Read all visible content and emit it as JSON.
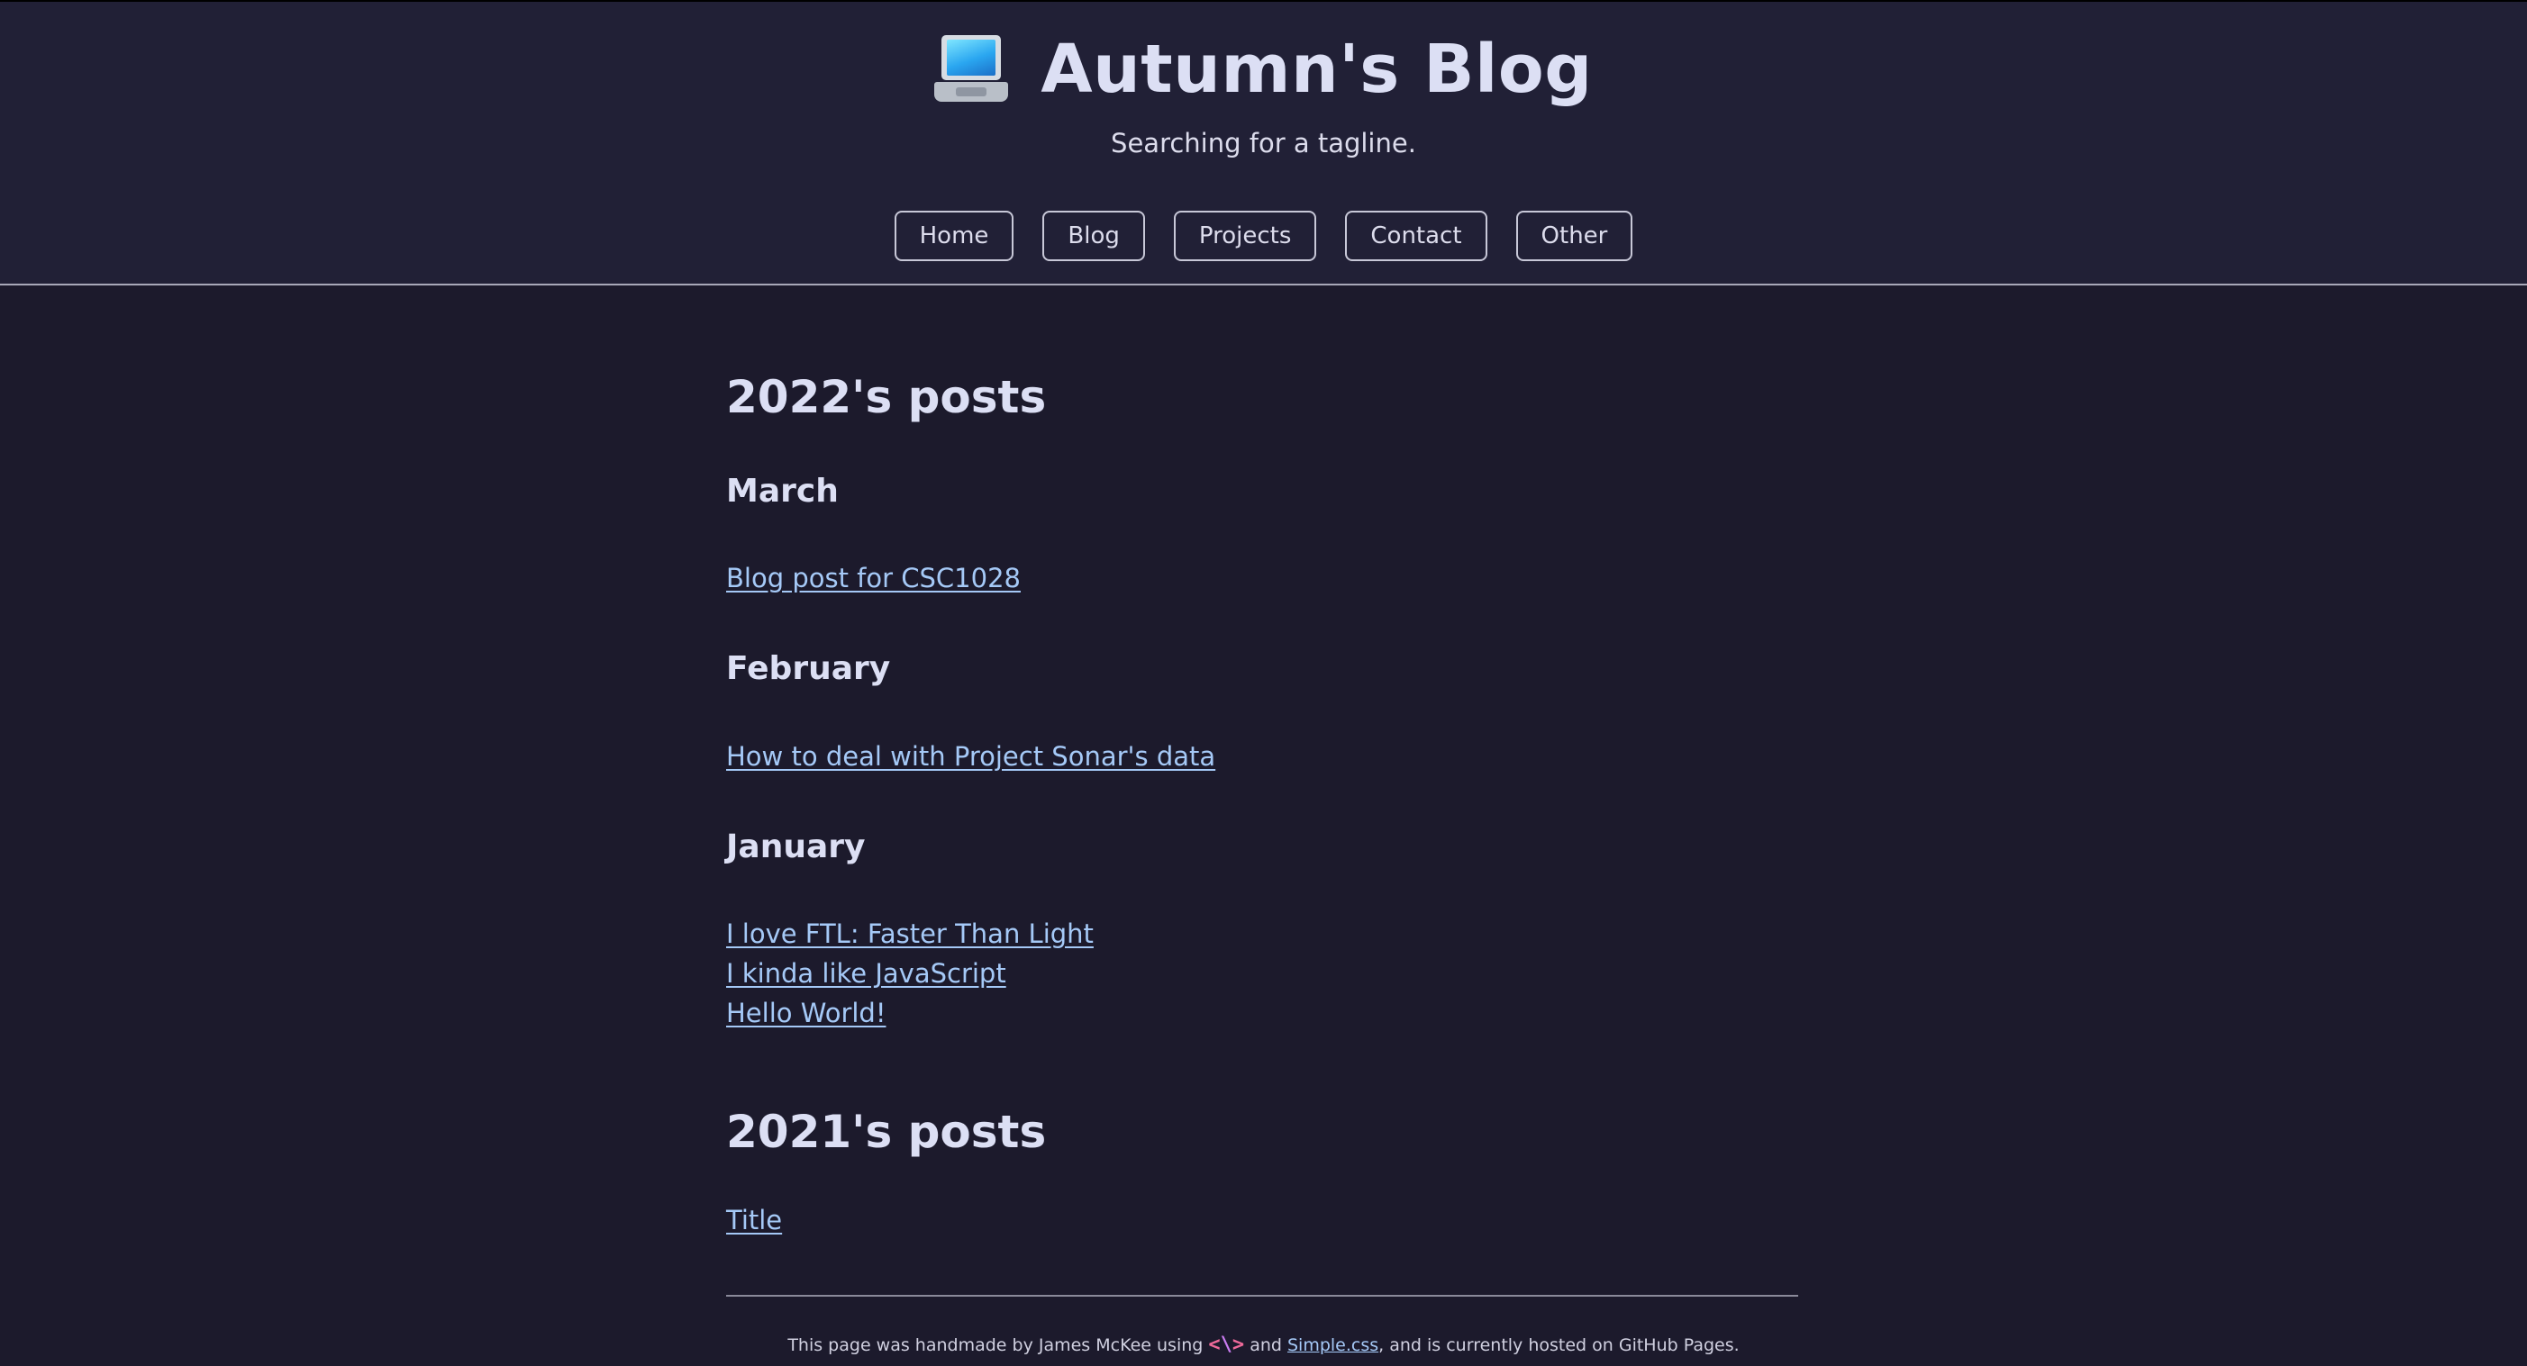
{
  "site": {
    "title": "Autumn's Blog",
    "tagline": "Searching for a tagline.",
    "logo_icon": "laptop-icon"
  },
  "nav": {
    "items": [
      {
        "label": "Home"
      },
      {
        "label": "Blog"
      },
      {
        "label": "Projects"
      },
      {
        "label": "Contact"
      },
      {
        "label": "Other"
      }
    ]
  },
  "archive": {
    "year_2022": {
      "heading": "2022's posts",
      "months": [
        {
          "name": "March",
          "posts": [
            "Blog post for CSC1028"
          ]
        },
        {
          "name": "February",
          "posts": [
            "How to deal with Project Sonar's data"
          ]
        },
        {
          "name": "January",
          "posts": [
            "I love FTL: Faster Than Light",
            "I kinda like JavaScript",
            "Hello World!"
          ]
        }
      ]
    },
    "year_2021": {
      "heading": "2021's posts",
      "posts": [
        "Title"
      ]
    }
  },
  "footer": {
    "text_before": "This page was handmade by James McKee using",
    "code_lt": "<",
    "code_slash": "\\",
    "code_gt": ">",
    "text_and": "and",
    "link_label": "Simple.css",
    "text_after": ", and is currently hosted on GitHub Pages."
  },
  "colors": {
    "background": "#1c1a2c",
    "header_background": "#212036",
    "link": "#a5c9f7",
    "text": "#dcdcf0"
  }
}
